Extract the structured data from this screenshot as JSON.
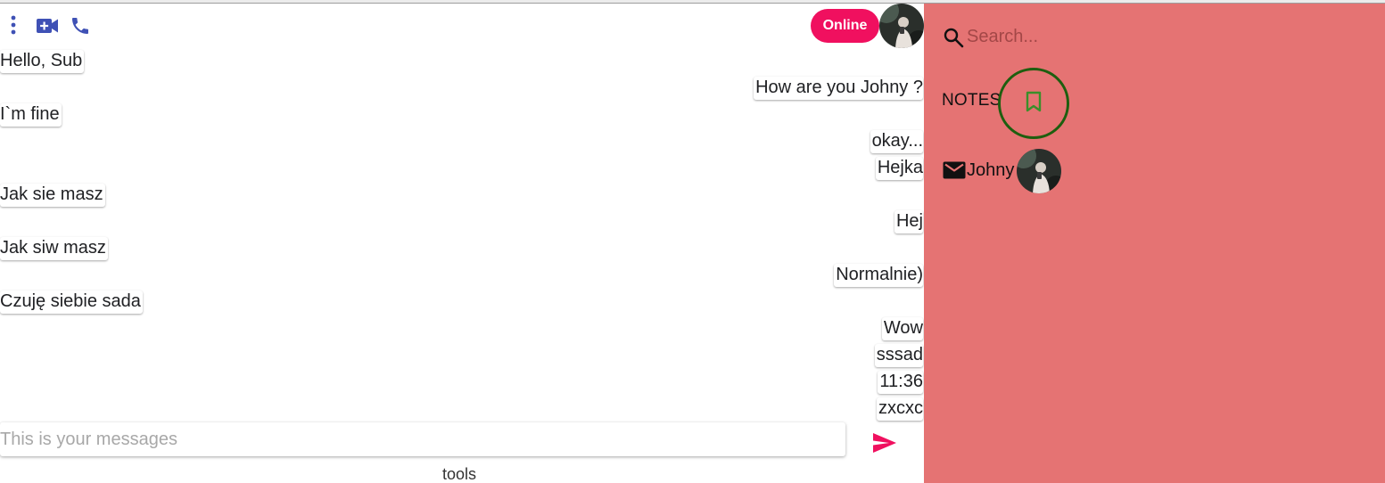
{
  "chat": {
    "status_label": "Online",
    "header_icons": [
      "more-vert-icon",
      "video-call-icon",
      "phone-icon"
    ],
    "messages": [
      {
        "side": "left",
        "text": "Hello, Sub"
      },
      {
        "side": "right",
        "text": "How are you Johny ?"
      },
      {
        "side": "left",
        "text": "I`m fine"
      },
      {
        "side": "right",
        "text": "okay..."
      },
      {
        "side": "right",
        "text": "Hejka"
      },
      {
        "side": "left",
        "text": "Jak sie masz"
      },
      {
        "side": "right",
        "text": "Hej"
      },
      {
        "side": "left",
        "text": "Jak siw masz"
      },
      {
        "side": "right",
        "text": "Normalnie)"
      },
      {
        "side": "left",
        "text": "Czuję siebie sada"
      },
      {
        "side": "right",
        "text": "Wow"
      },
      {
        "side": "right",
        "text": "sssad"
      },
      {
        "side": "right",
        "text": "11:36"
      },
      {
        "side": "right",
        "text": "zxcxc"
      }
    ],
    "input_placeholder": "This is your messages",
    "input_value": "",
    "tools_label": "tools"
  },
  "sidebar": {
    "search_placeholder": "Search...",
    "notes_label": "NOTES",
    "contacts": [
      {
        "name": "Johny",
        "icon": "mail-icon"
      }
    ]
  },
  "colors": {
    "accent": "#f0105f",
    "sidebar_bg": "#e57373",
    "header_icon": "#3f51b5",
    "notes_ring": "#1e5e0f",
    "bookmark_icon": "#3a8f2a"
  }
}
